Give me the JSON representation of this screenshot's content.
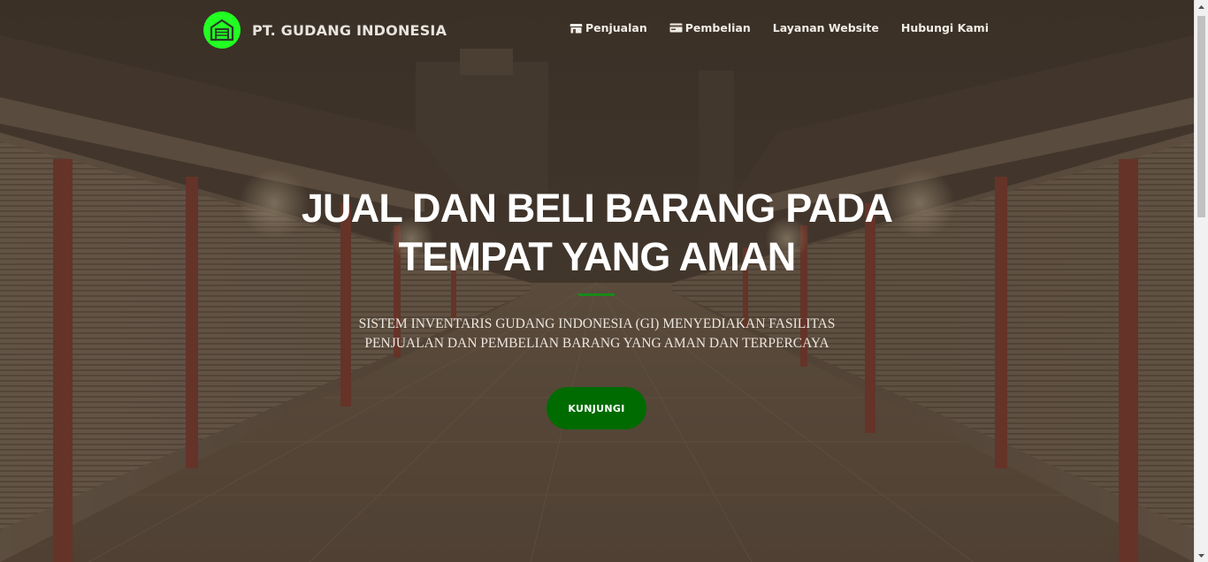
{
  "nav": {
    "brand": "PT. GUDANG INDONESIA",
    "logo_icon": "warehouse-icon",
    "items": [
      {
        "label": "Penjualan",
        "icon": "store-icon"
      },
      {
        "label": "Pembelian",
        "icon": "card-icon"
      },
      {
        "label": "Layanan Website"
      },
      {
        "label": "Hubungi Kami"
      }
    ]
  },
  "hero": {
    "headline_line1": "JUAL DAN BELI BARANG PADA",
    "headline_line2": "TEMPAT YANG AMAN",
    "subtitle_line1": "SISTEM INVENTARIS GUDANG INDONESIA (GI) MENYEDIAKAN FASILITAS",
    "subtitle_line2": "PENJUALAN DAN PEMBELIAN BARANG YANG AMAN DAN TERPERCAYA",
    "cta": "KUNJUNGI"
  },
  "colors": {
    "accent": "#006b00",
    "logo_bg": "#22ff22",
    "divider": "#188a18",
    "overlay": "#5a4838"
  }
}
